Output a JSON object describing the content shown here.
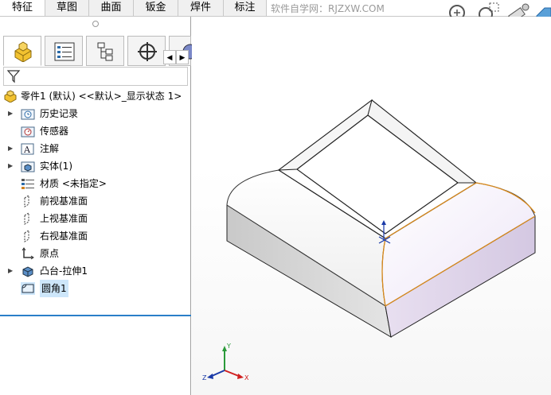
{
  "tabs": [
    {
      "label": "特征",
      "active": true
    },
    {
      "label": "草图",
      "active": false
    },
    {
      "label": "曲面",
      "active": false
    },
    {
      "label": "钣金",
      "active": false
    },
    {
      "label": "焊件",
      "active": false
    },
    {
      "label": "标注",
      "active": false
    }
  ],
  "watermark": "软件自学网：RJZXW.COM",
  "view_toolbar": [
    "zoom-to-fit-icon",
    "zoom-area-icon",
    "previous-view-icon",
    "section-view-icon"
  ],
  "panel_tabs": [
    "featuremanager-tab-icon",
    "propertymanager-tab-icon",
    "configurationmanager-tab-icon",
    "dimxpert-tab-icon"
  ],
  "tree": {
    "root": "零件1 (默认) <<默认>_显示状态 1>",
    "items": [
      {
        "label": "历史记录",
        "expandable": true,
        "icon": "history-folder-icon"
      },
      {
        "label": "传感器",
        "expandable": false,
        "icon": "sensor-icon"
      },
      {
        "label": "注解",
        "expandable": true,
        "icon": "annotation-icon"
      },
      {
        "label": "实体(1)",
        "expandable": true,
        "icon": "solid-bodies-icon"
      },
      {
        "label": "材质 <未指定>",
        "expandable": false,
        "icon": "material-icon"
      },
      {
        "label": "前视基准面",
        "expandable": false,
        "icon": "plane-icon"
      },
      {
        "label": "上视基准面",
        "expandable": false,
        "icon": "plane-icon"
      },
      {
        "label": "右视基准面",
        "expandable": false,
        "icon": "plane-icon"
      },
      {
        "label": "原点",
        "expandable": false,
        "icon": "origin-icon"
      },
      {
        "label": "凸台-拉伸1",
        "expandable": true,
        "icon": "boss-extrude-icon"
      },
      {
        "label": "圆角1",
        "expandable": false,
        "icon": "fillet-icon",
        "selected": true
      }
    ]
  },
  "triad": {
    "x": "X",
    "y": "Y",
    "z": "Z"
  },
  "colors": {
    "accent": "#2a7fc8",
    "edge_highlight": "#d98a1c",
    "side_face": "#dcd0e6"
  }
}
